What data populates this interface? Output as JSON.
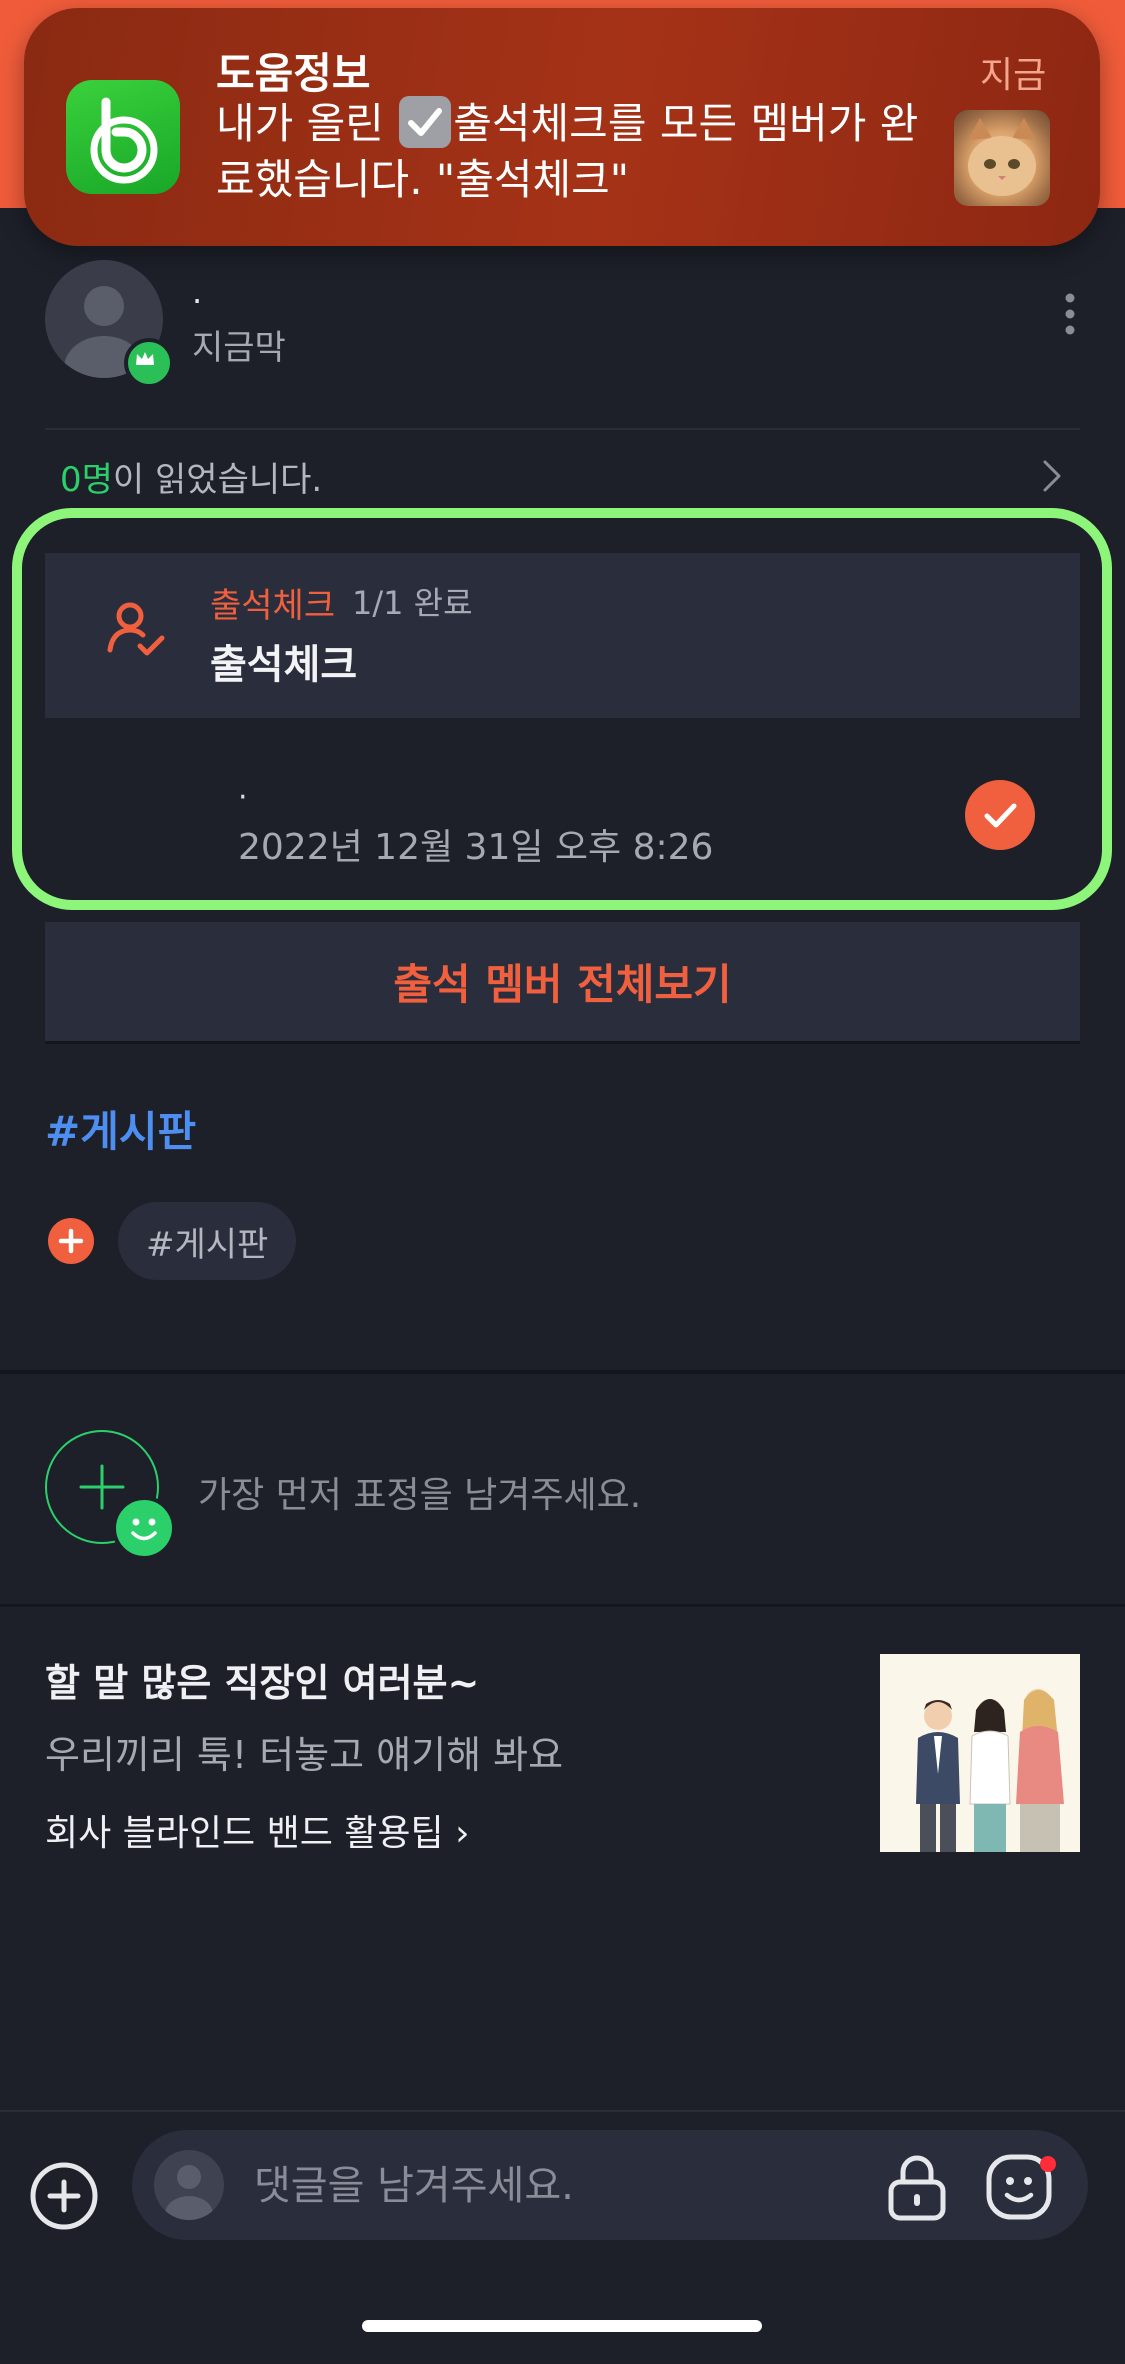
{
  "notification": {
    "app_name": "도움정보",
    "time": "지금",
    "body_before": "내가 올린 ",
    "body_after": "출석체크를 모든 멤버가 완료했습니다. \"출석체크\""
  },
  "post": {
    "author_name": "·",
    "author_time": "지금막",
    "read_count": "0명",
    "read_suffix": "이 읽었습니다."
  },
  "attendance": {
    "label": "출석체크",
    "count": "1/1 완료",
    "title": "출석체크",
    "member_name": "·",
    "member_time": "2022년 12월 31일 오후 8:26",
    "view_all": "출석 멤버 전체보기"
  },
  "tags": {
    "heading": "#게시판",
    "chip": "#게시판"
  },
  "reactions": {
    "prompt": "가장 먼저 표정을 남겨주세요."
  },
  "promo": {
    "title": "할 말 많은 직장인 여러분~",
    "subtitle": "우리끼리 툭! 터놓고 얘기해 봐요",
    "link": "회사 블라인드 밴드 활용팁"
  },
  "comment_bar": {
    "placeholder": "댓글을 남겨주세요."
  },
  "colors": {
    "accent": "#f0603e",
    "highlight": "#8cf57a",
    "green": "#2bd06a",
    "tag_blue": "#4d8ef0"
  }
}
